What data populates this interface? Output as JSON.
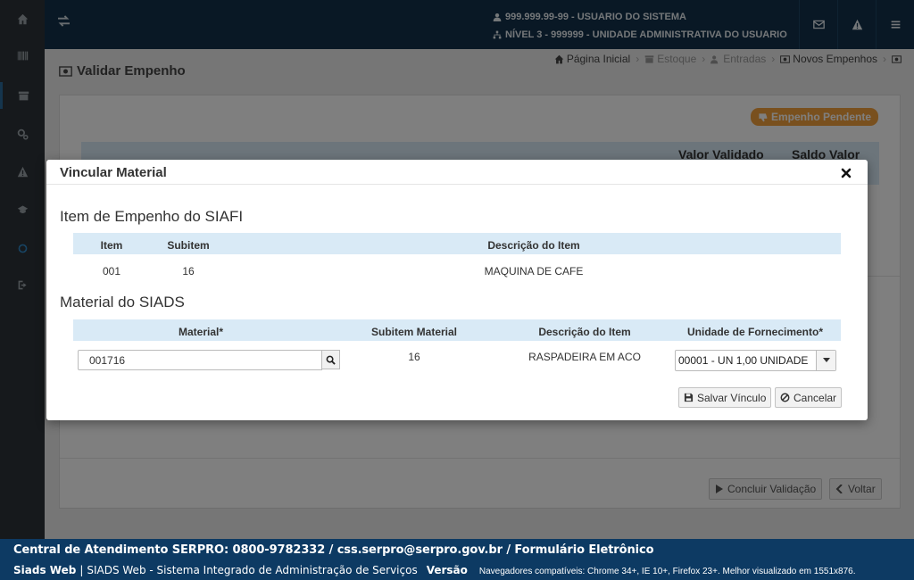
{
  "topbar": {
    "user_line": "999.999.99-99 - USUARIO DO SISTEMA",
    "level_line": "NÍVEL 3 - 999999 - UNIDADE ADMINISTRATIVA DO USUARIO"
  },
  "page": {
    "title": "Validar Empenho"
  },
  "breadcrumb": {
    "home": "Página Inicial",
    "estoque": "Estoque",
    "entradas": "Entradas",
    "novos_empenhos": "Novos Empenhos"
  },
  "panel": {
    "badge": "Empenho Pendente",
    "col_valor_validado": "Valor Validado",
    "col_saldo_valor": "Saldo Valor",
    "concluir_label": "Concluir Validação",
    "voltar_label": "Voltar"
  },
  "modal": {
    "title": "Vincular Material",
    "siafi_section_title": "Item de Empenho do SIAFI",
    "siafi_table": {
      "headers": [
        "Item",
        "Subitem",
        "Descrição do Item"
      ],
      "rows": [
        [
          "001",
          "16",
          "MAQUINA DE CAFE"
        ]
      ]
    },
    "siads_section_title": "Material do SIADS",
    "siads_table": {
      "headers": [
        "Material*",
        "Subitem Material",
        "Descrição do Item",
        "Unidade de Fornecimento*"
      ],
      "material_value": "001716",
      "subitem": "16",
      "descricao": "RASPADEIRA EM ACO",
      "unidade_selected": "00001 - UN 1,00 UNIDADE"
    },
    "save_label": "Salvar Vínculo",
    "cancel_label": "Cancelar"
  },
  "footer": {
    "line1": "Central de Atendimento SERPRO: 0800-9782332 / css.serpro@serpro.gov.br / Formulário Eletrônico",
    "app_name": "Siads Web",
    "pipe": "|",
    "app_desc": "SIADS Web - Sistema Integrado de Administração de Serviços",
    "version_label": "Versão",
    "browsers": "Navegadores compatíveis: Chrome 34+, IE 10+, Firefox 23+. Melhor visualizado em 1551x876."
  },
  "colors": {
    "topbar": "#13314a",
    "sidebar": "#2c3338",
    "footer": "#0d3a63",
    "table_header": "#d9eaf6",
    "badge": "#f2a03c"
  }
}
